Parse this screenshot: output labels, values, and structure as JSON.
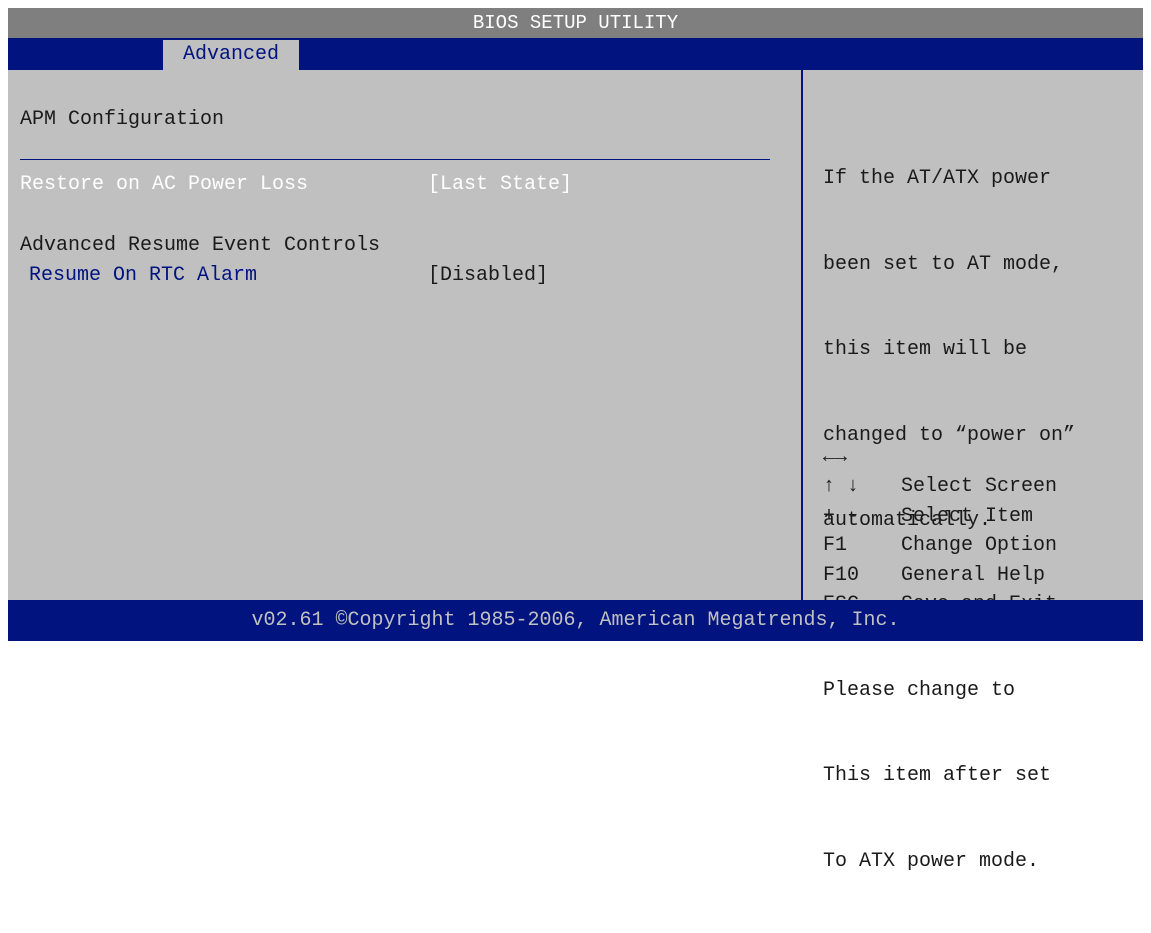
{
  "title": "BIOS SETUP UTILITY",
  "tabs": [
    {
      "label": "Advanced",
      "active": true
    }
  ],
  "main": {
    "section_title": "APM Configuration",
    "restore": {
      "label": "Restore on AC Power Loss",
      "value": "[Last State]"
    },
    "group_title": "Advanced Resume Event Controls",
    "rtc": {
      "label": "Resume On RTC Alarm",
      "value": "[Disabled]"
    }
  },
  "help": {
    "lines1": [
      "If the AT/ATX power",
      "been set to AT mode,",
      "this item will be",
      "changed to “power on”",
      "automatically."
    ],
    "lines2": [
      "Please change to",
      "This item after set",
      "To ATX power mode."
    ]
  },
  "keys": [
    {
      "key": "←→",
      "desc": "Select Screen"
    },
    {
      "key": "↑ ↓",
      "desc": "Select Item"
    },
    {
      "key": "+ -",
      "desc": "Change Option"
    },
    {
      "key": "F1",
      "desc": "General Help"
    },
    {
      "key": "F10",
      "desc": "Save and Exit"
    },
    {
      "key": "ESC",
      "desc": "Exit"
    }
  ],
  "footer": "v02.61 ©Copyright 1985-2006, American Megatrends, Inc.",
  "colors": {
    "bios_blue": "#00137f",
    "bios_gray": "#c0c0c0",
    "title_gray": "#7f7f7f",
    "text": "#1a1a1a",
    "highlight": "#ffffff"
  }
}
